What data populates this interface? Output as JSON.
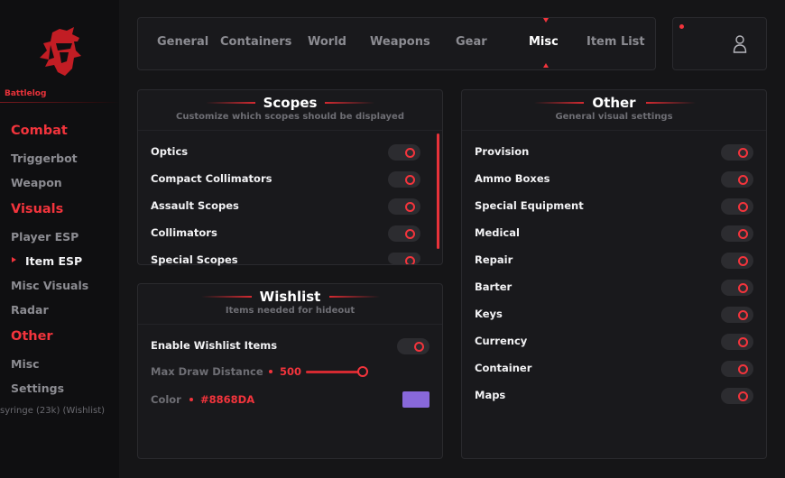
{
  "brand": {
    "name": "Battlelog",
    "accent": "#F2343C"
  },
  "sidebar": {
    "sections": [
      {
        "title": "Combat",
        "items": [
          {
            "label": "Triggerbot"
          },
          {
            "label": "Weapon"
          }
        ]
      },
      {
        "title": "Visuals",
        "items": [
          {
            "label": "Player ESP"
          },
          {
            "label": "Item ESP",
            "active": true
          },
          {
            "label": "Misc Visuals"
          },
          {
            "label": "Radar"
          }
        ]
      },
      {
        "title": "Other",
        "items": [
          {
            "label": "Misc"
          },
          {
            "label": "Settings"
          }
        ]
      }
    ],
    "ghost_text": "syringe (23k) (Wishlist)"
  },
  "tabs": [
    {
      "label": "General"
    },
    {
      "label": "Containers"
    },
    {
      "label": "World"
    },
    {
      "label": "Weapons"
    },
    {
      "label": "Gear"
    },
    {
      "label": "Misc",
      "active": true
    },
    {
      "label": "Item List"
    }
  ],
  "user": {
    "icon": "user-icon",
    "status_color": "#F2343C"
  },
  "scopes": {
    "title": "Scopes",
    "subtitle": "Customize which scopes should be displayed",
    "items": [
      {
        "label": "Optics",
        "enabled": false
      },
      {
        "label": "Compact Collimators",
        "enabled": false
      },
      {
        "label": "Assault Scopes",
        "enabled": false
      },
      {
        "label": "Collimators",
        "enabled": false
      },
      {
        "label": "Special Scopes",
        "enabled": false
      }
    ]
  },
  "wishlist": {
    "title": "Wishlist",
    "subtitle": "Items needed for hideout",
    "enable_label": "Enable Wishlist Items",
    "enable_on": false,
    "distance_label": "Max Draw Distance",
    "distance_value": "500",
    "distance_fraction": 1.0,
    "color_label": "Color",
    "color_value": "#8868DA"
  },
  "other": {
    "title": "Other",
    "subtitle": "General visual settings",
    "items": [
      {
        "label": "Provision",
        "enabled": false
      },
      {
        "label": "Ammo Boxes",
        "enabled": false
      },
      {
        "label": "Special Equipment",
        "enabled": false
      },
      {
        "label": "Medical",
        "enabled": false
      },
      {
        "label": "Repair",
        "enabled": false
      },
      {
        "label": "Barter",
        "enabled": false
      },
      {
        "label": "Keys",
        "enabled": false
      },
      {
        "label": "Currency",
        "enabled": false
      },
      {
        "label": "Container",
        "enabled": false
      },
      {
        "label": "Maps",
        "enabled": false
      }
    ]
  }
}
